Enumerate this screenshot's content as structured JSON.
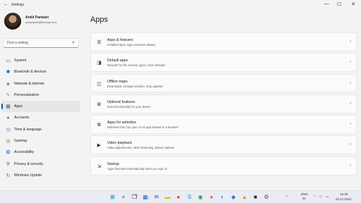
{
  "window": {
    "app_title": "Settings",
    "back_glyph": "←",
    "minimize_glyph": "—",
    "maximize_glyph": "☐",
    "close_glyph": "✕"
  },
  "profile": {
    "name": "Ankit Panwari",
    "email": "panwiankit@hotmail.com"
  },
  "search": {
    "placeholder": "Find a setting"
  },
  "nav": {
    "items": [
      {
        "label": "System",
        "icon": "monitor-icon",
        "color": "#0078d4"
      },
      {
        "label": "Bluetooth & devices",
        "icon": "bluetooth-icon",
        "color": "#0063b1"
      },
      {
        "label": "Network & internet",
        "icon": "wifi-icon",
        "color": "#5a6b8c"
      },
      {
        "label": "Personalization",
        "icon": "brush-icon",
        "color": "#e07a1f"
      },
      {
        "label": "Apps",
        "icon": "apps-icon",
        "color": "#4a5a7a",
        "active": true
      },
      {
        "label": "Accounts",
        "icon": "person-icon",
        "color": "#23a36a"
      },
      {
        "label": "Time & language",
        "icon": "globe-clock-icon",
        "color": "#1e7bd8"
      },
      {
        "label": "Gaming",
        "icon": "gamepad-icon",
        "color": "#6b6b6b"
      },
      {
        "label": "Accessibility",
        "icon": "accessibility-icon",
        "color": "#2a6fd6"
      },
      {
        "label": "Privacy & security",
        "icon": "shield-icon",
        "color": "#6b6b6b"
      },
      {
        "label": "Windows Update",
        "icon": "update-icon",
        "color": "#1e7bd8"
      }
    ]
  },
  "main": {
    "title": "Apps",
    "cards": [
      {
        "title": "Apps & features",
        "subtitle": "Installed apps, app execution aliases",
        "icon": "list-icon"
      },
      {
        "title": "Default apps",
        "subtitle": "Defaults for file and link types, other defaults",
        "icon": "default-apps-icon"
      },
      {
        "title": "Offline maps",
        "subtitle": "Downloads, storage location, map updates",
        "icon": "map-icon"
      },
      {
        "title": "Optional features",
        "subtitle": "Extra functionality for your device",
        "icon": "optional-features-icon"
      },
      {
        "title": "Apps for websites",
        "subtitle": "Websites that can open in an app instead of a browser",
        "icon": "apps-websites-icon"
      },
      {
        "title": "Video playback",
        "subtitle": "Video adjustments, HDR streaming, battery options",
        "icon": "video-icon"
      },
      {
        "title": "Startup",
        "subtitle": "Apps that start automatically when you sign in",
        "icon": "startup-icon"
      }
    ],
    "chevron_glyph": "›"
  },
  "taskbar": {
    "icons": [
      {
        "name": "start-icon",
        "glyph": "⊞",
        "color": "#0078d4"
      },
      {
        "name": "search-icon",
        "glyph": "⌕",
        "color": "#222222"
      },
      {
        "name": "task-view-icon",
        "glyph": "❐",
        "color": "#222222"
      },
      {
        "name": "widgets-icon",
        "glyph": "▦",
        "color": "#2a6fd6"
      },
      {
        "name": "chat-icon",
        "glyph": "✉",
        "color": "#6b4cc9"
      },
      {
        "name": "file-explorer-icon",
        "glyph": "▬",
        "color": "#e8b527"
      },
      {
        "name": "app-icon-red",
        "glyph": "●",
        "color": "#d83b2b"
      },
      {
        "name": "skype-icon",
        "glyph": "S",
        "color": "#1a8cd8"
      },
      {
        "name": "chrome-icon",
        "glyph": "◉",
        "color": "#2c9a48"
      },
      {
        "name": "firefox-icon",
        "glyph": "●",
        "color": "#e8661f"
      },
      {
        "name": "edge-icon",
        "glyph": "◐",
        "color": "#1a9ad6"
      },
      {
        "name": "app-icon-blue",
        "glyph": "◆",
        "color": "#3b6fd8"
      },
      {
        "name": "vlc-icon",
        "glyph": "▲",
        "color": "#e88a12"
      },
      {
        "name": "app-icon-dark",
        "glyph": "■",
        "color": "#2b2b2b"
      },
      {
        "name": "settings-icon",
        "glyph": "⚙",
        "color": "#555555"
      }
    ],
    "tray": {
      "chevron": "^",
      "lang_top": "ENG",
      "lang_bottom": "IN",
      "time": "16:38",
      "date": "23-11-2021"
    }
  }
}
